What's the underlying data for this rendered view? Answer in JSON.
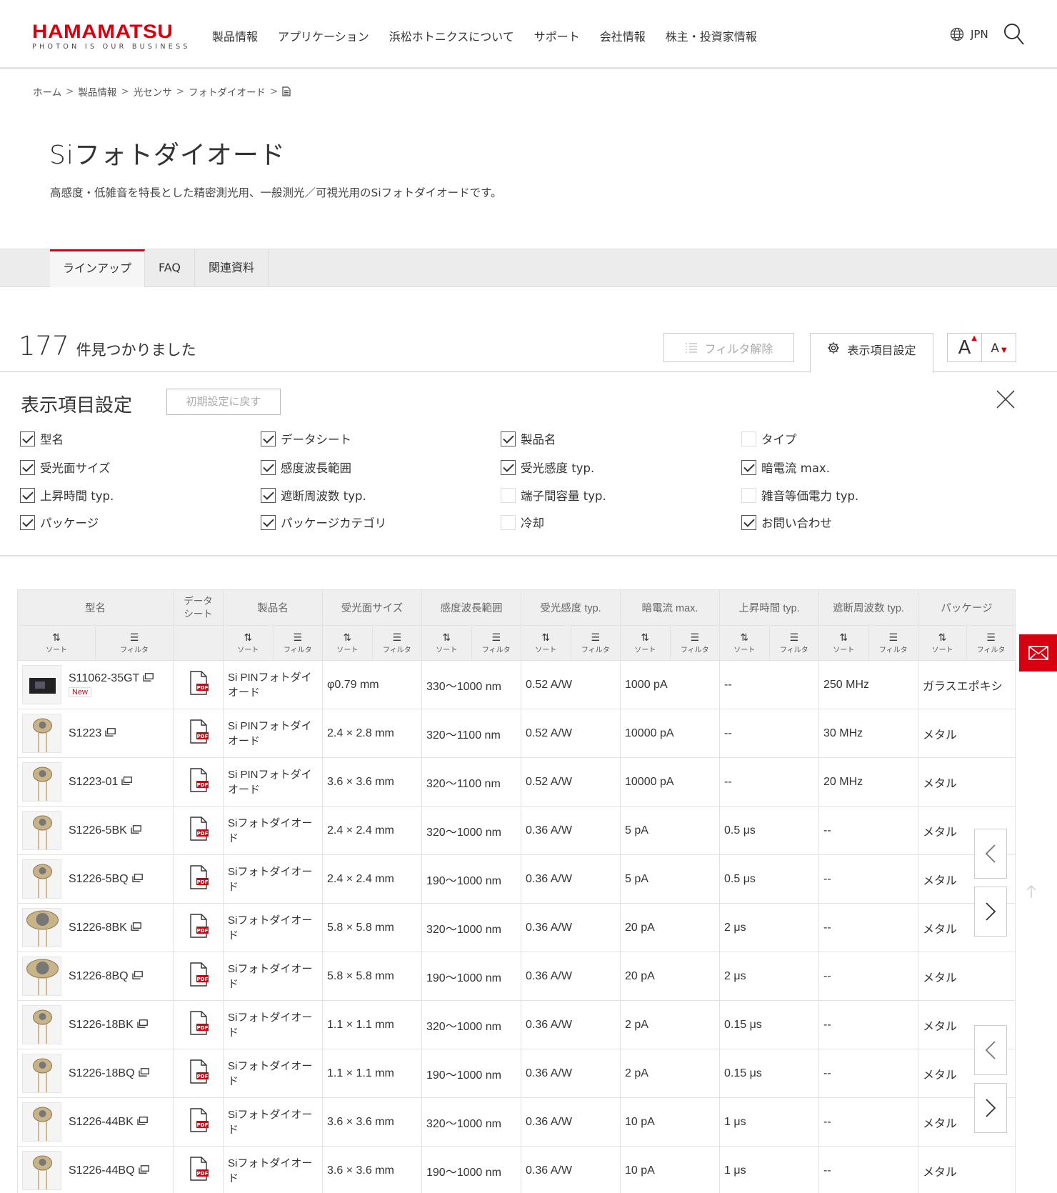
{
  "header": {
    "logo": "HAMAMATSU",
    "tagline": "PHOTON IS OUR BUSINESS",
    "nav": [
      "製品情報",
      "アプリケーション",
      "浜松ホトニクスについて",
      "サポート",
      "会社情報",
      "株主・投資家情報"
    ],
    "language": "JPN"
  },
  "breadcrumb": [
    "ホーム",
    "製品情報",
    "光センサ",
    "フォトダイオード"
  ],
  "page": {
    "title": "Siフォトダイオード",
    "lead": "高感度・低雑音を特長とした精密測光用、一般測光／可視光用のSiフォトダイオードです。"
  },
  "tabs": [
    "ラインアップ",
    "FAQ",
    "関連資料"
  ],
  "results": {
    "count": "177",
    "label": "件見つかりました",
    "filter_clear": "フィルタ解除",
    "display_settings": "表示項目設定",
    "font_large": "A",
    "font_small": "A"
  },
  "settings": {
    "title": "表示項目設定",
    "reset": "初期設定に戻す",
    "options": [
      {
        "label": "型名",
        "checked": true
      },
      {
        "label": "データシート",
        "checked": true
      },
      {
        "label": "製品名",
        "checked": true
      },
      {
        "label": "タイプ",
        "checked": false
      },
      {
        "label": "受光面サイズ",
        "checked": true
      },
      {
        "label": "感度波長範囲",
        "checked": true
      },
      {
        "label": "受光感度 typ.",
        "checked": true
      },
      {
        "label": "暗電流 max.",
        "checked": true
      },
      {
        "label": "上昇時間 typ.",
        "checked": true
      },
      {
        "label": "遮断周波数 typ.",
        "checked": true
      },
      {
        "label": "端子間容量 typ.",
        "checked": false
      },
      {
        "label": "雑音等価電力 typ.",
        "checked": false
      },
      {
        "label": "パッケージ",
        "checked": true
      },
      {
        "label": "パッケージカテゴリ",
        "checked": true
      },
      {
        "label": "冷却",
        "checked": false
      },
      {
        "label": "お問い合わせ",
        "checked": true
      }
    ]
  },
  "table": {
    "headers": [
      "型名",
      "データシート",
      "製品名",
      "受光面サイズ",
      "感度波長範囲",
      "受光感度 typ.",
      "暗電流 max.",
      "上昇時間 typ.",
      "遮断周波数 typ.",
      "パッケージ"
    ],
    "sort_label": "ソート",
    "filter_label": "フィルタ",
    "new_label": "New",
    "rows": [
      {
        "model": "S11062-35GT",
        "is_new": true,
        "name": "Si PINフォトダイオード",
        "area": "φ0.79 mm",
        "range": "330～1000 nm",
        "sens": "0.52 A/W",
        "dark": "1000 pA",
        "rise": "--",
        "cutoff": "250 MHz",
        "pkg": "ガラスエポキシ"
      },
      {
        "model": "S1223",
        "is_new": false,
        "name": "Si PINフォトダイオード",
        "area": "2.4 × 2.8 mm",
        "range": "320～1100 nm",
        "sens": "0.52 A/W",
        "dark": "10000 pA",
        "rise": "--",
        "cutoff": "30 MHz",
        "pkg": "メタル"
      },
      {
        "model": "S1223-01",
        "is_new": false,
        "name": "Si PINフォトダイオード",
        "area": "3.6 × 3.6 mm",
        "range": "320～1100 nm",
        "sens": "0.52 A/W",
        "dark": "10000 pA",
        "rise": "--",
        "cutoff": "20 MHz",
        "pkg": "メタル"
      },
      {
        "model": "S1226-5BK",
        "is_new": false,
        "name": "Siフォトダイオード",
        "area": "2.4 × 2.4 mm",
        "range": "320～1000 nm",
        "sens": "0.36 A/W",
        "dark": "5 pA",
        "rise": "0.5 μs",
        "cutoff": "--",
        "pkg": "メタル"
      },
      {
        "model": "S1226-5BQ",
        "is_new": false,
        "name": "Siフォトダイオード",
        "area": "2.4 × 2.4 mm",
        "range": "190～1000 nm",
        "sens": "0.36 A/W",
        "dark": "5 pA",
        "rise": "0.5 μs",
        "cutoff": "--",
        "pkg": "メタル"
      },
      {
        "model": "S1226-8BK",
        "is_new": false,
        "name": "Siフォトダイオード",
        "area": "5.8 × 5.8 mm",
        "range": "320～1000 nm",
        "sens": "0.36 A/W",
        "dark": "20 pA",
        "rise": "2 μs",
        "cutoff": "--",
        "pkg": "メタル"
      },
      {
        "model": "S1226-8BQ",
        "is_new": false,
        "name": "Siフォトダイオード",
        "area": "5.8 × 5.8 mm",
        "range": "190～1000 nm",
        "sens": "0.36 A/W",
        "dark": "20 pA",
        "rise": "2 μs",
        "cutoff": "--",
        "pkg": "メタル"
      },
      {
        "model": "S1226-18BK",
        "is_new": false,
        "name": "Siフォトダイオード",
        "area": "1.1 × 1.1 mm",
        "range": "320～1000 nm",
        "sens": "0.36 A/W",
        "dark": "2 pA",
        "rise": "0.15 μs",
        "cutoff": "--",
        "pkg": "メタル"
      },
      {
        "model": "S1226-18BQ",
        "is_new": false,
        "name": "Siフォトダイオード",
        "area": "1.1 × 1.1 mm",
        "range": "190～1000 nm",
        "sens": "0.36 A/W",
        "dark": "2 pA",
        "rise": "0.15 μs",
        "cutoff": "--",
        "pkg": "メタル"
      },
      {
        "model": "S1226-44BK",
        "is_new": false,
        "name": "Siフォトダイオード",
        "area": "3.6 × 3.6 mm",
        "range": "320～1000 nm",
        "sens": "0.36 A/W",
        "dark": "10 pA",
        "rise": "1 μs",
        "cutoff": "--",
        "pkg": "メタル"
      },
      {
        "model": "S1226-44BQ",
        "is_new": false,
        "name": "Siフォトダイオード",
        "area": "3.6 × 3.6 mm",
        "range": "190～1000 nm",
        "sens": "0.36 A/W",
        "dark": "10 pA",
        "rise": "1 μs",
        "cutoff": "--",
        "pkg": "メタル"
      }
    ]
  },
  "colors": {
    "brand": "#d7000f",
    "header_bg": "#efefef"
  },
  "icons": [
    "globe-icon",
    "search-icon",
    "document-icon",
    "filter-list-icon",
    "gear-icon",
    "close-icon",
    "sort-icon",
    "new-window-icon",
    "pdf-icon",
    "mail-icon",
    "chevron-left-icon",
    "chevron-right-icon",
    "arrow-up-icon"
  ]
}
